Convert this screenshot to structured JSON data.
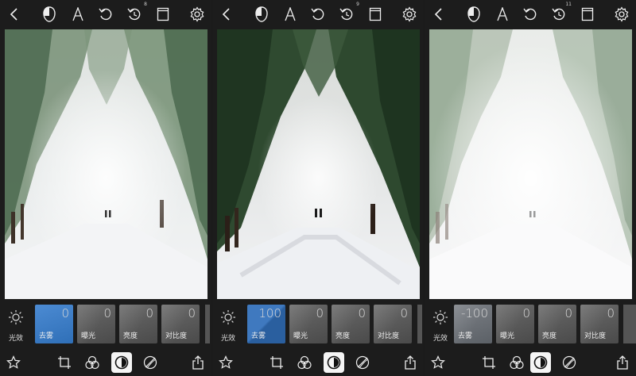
{
  "panels": [
    {
      "history_count": "8",
      "category_label": "光效",
      "tiles": [
        {
          "value": "0",
          "label": "去雾"
        },
        {
          "value": "0",
          "label": "曝光"
        },
        {
          "value": "0",
          "label": "亮度"
        },
        {
          "value": "0",
          "label": "对比度"
        }
      ]
    },
    {
      "history_count": "9",
      "category_label": "光效",
      "tiles": [
        {
          "value": "100",
          "label": "去雾"
        },
        {
          "value": "0",
          "label": "曝光"
        },
        {
          "value": "0",
          "label": "亮度"
        },
        {
          "value": "0",
          "label": "对比度"
        }
      ]
    },
    {
      "history_count": "11",
      "category_label": "光效",
      "tiles": [
        {
          "value": "-100",
          "label": "去雾"
        },
        {
          "value": "0",
          "label": "曝光"
        },
        {
          "value": "0",
          "label": "亮度"
        },
        {
          "value": "0",
          "label": "对比度"
        }
      ]
    }
  ],
  "top_icons": [
    "back-icon",
    "mask-icon",
    "text-icon",
    "undo-icon",
    "history-icon",
    "crop-frame-icon",
    "settings-icon"
  ],
  "bottom_icons": [
    "star-icon",
    "crop-icon",
    "filters-icon",
    "adjust-icon",
    "curves-icon",
    "share-icon"
  ],
  "colors": {
    "accent": "#3a78c0",
    "background": "#1c1c1c"
  }
}
